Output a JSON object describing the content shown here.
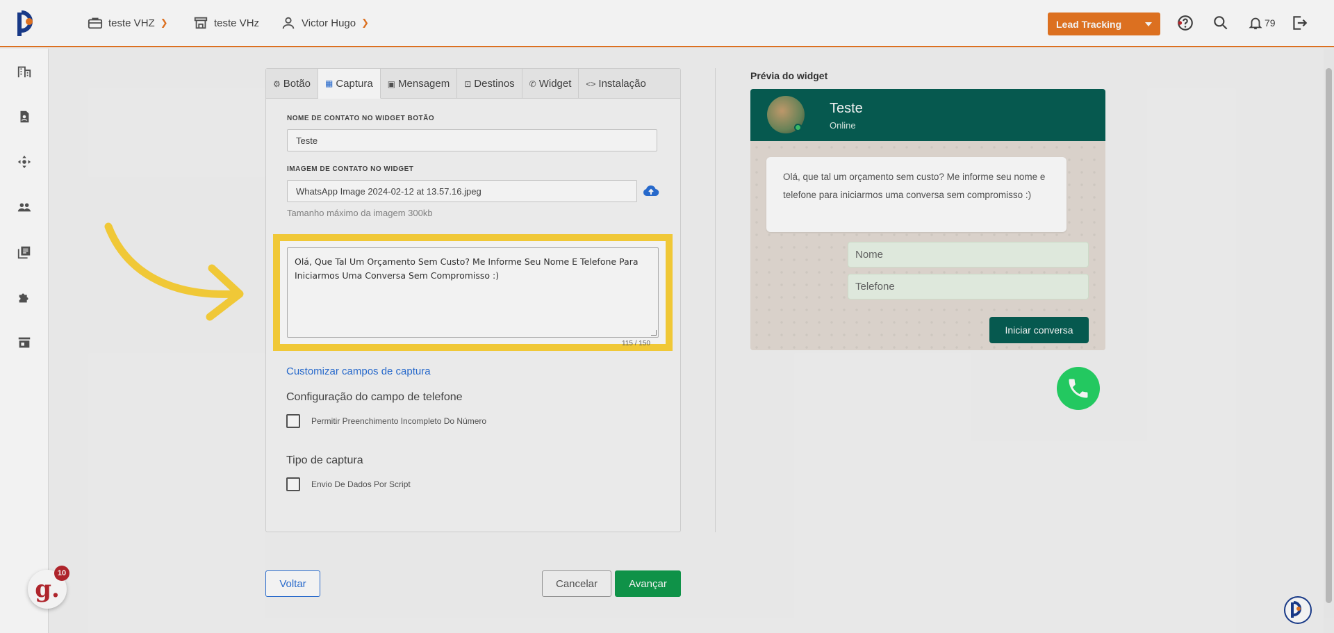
{
  "topbar": {
    "workspace": "teste VHZ",
    "store": "teste VHz",
    "user": "Victor Hugo",
    "lead_button": "Lead Tracking",
    "notifications": "79"
  },
  "tabs": [
    {
      "label": "Botão",
      "icon": "gear-icon"
    },
    {
      "label": "Captura",
      "icon": "grid-icon"
    },
    {
      "label": "Mensagem",
      "icon": "message-icon"
    },
    {
      "label": "Destinos",
      "icon": "target-icon"
    },
    {
      "label": "Widget",
      "icon": "whatsapp-icon"
    },
    {
      "label": "Instalação",
      "icon": "code-icon"
    }
  ],
  "form": {
    "contact_name_label": "NOME DE CONTATO NO WIDGET BOTÃO",
    "contact_name_value": "Teste",
    "contact_image_label": "IMAGEM DE CONTATO NO WIDGET",
    "contact_image_value": "WhatsApp Image 2024-02-12 at 13.57.16.jpeg",
    "image_hint": "Tamanho máximo da imagem 300kb",
    "message_value": "Olá, Que Tal Um Orçamento Sem Custo? Me Informe Seu Nome E Telefone Para Iniciarmos Uma Conversa Sem Compromisso :)",
    "char_counter": "115 / 150",
    "customize_link": "Customizar campos de captura",
    "phone_config_title": "Configuração do campo de telefone",
    "phone_incomplete_label": "Permitir Preenchimento Incompleto Do Número",
    "capture_type_title": "Tipo de captura",
    "script_capture_label": "Envio De Dados Por Script"
  },
  "preview": {
    "title": "Prévia do widget",
    "contact_name": "Teste",
    "status": "Online",
    "message": "Olá, que tal um orçamento sem custo? Me informe seu nome e telefone para iniciarmos uma conversa sem compromisso :)",
    "name_placeholder": "Nome",
    "phone_placeholder": "Telefone",
    "start_button": "Iniciar conversa"
  },
  "footer": {
    "back": "Voltar",
    "cancel": "Cancelar",
    "next": "Avançar"
  },
  "badges": {
    "g_count": "10"
  },
  "colors": {
    "accent": "#e87722",
    "highlight": "#fdd33a",
    "whatsapp_green": "#075e54",
    "primary_blue": "#2a6fd6",
    "success": "#109a4c"
  }
}
